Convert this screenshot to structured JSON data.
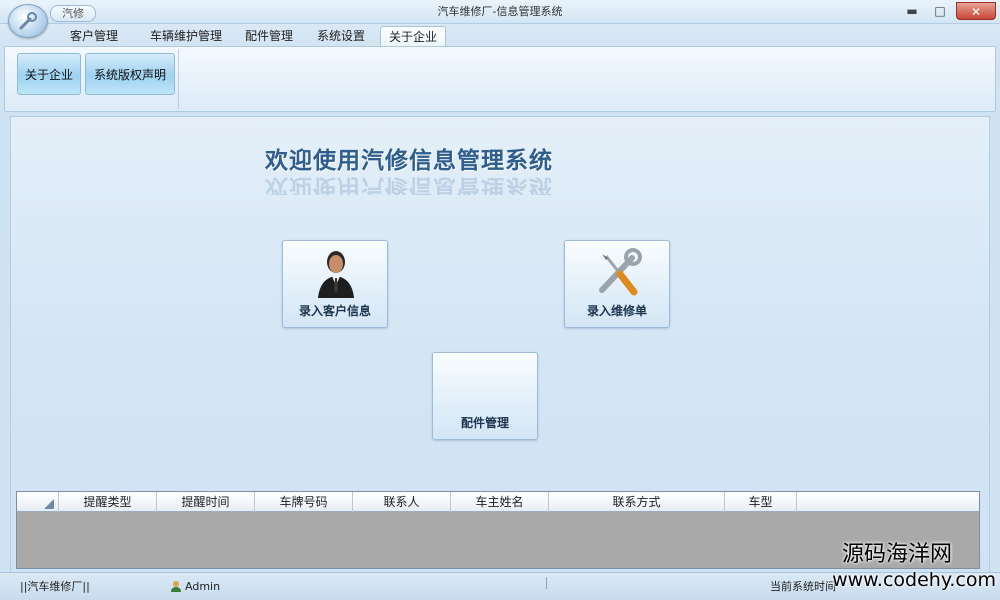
{
  "window": {
    "title": "汽车维修厂-信息管理系统",
    "quick_access": "汽修",
    "controls": {
      "minimize": "▬",
      "maximize": "□",
      "close": "✕"
    }
  },
  "tabs": [
    {
      "label": "客户管理",
      "active": false
    },
    {
      "label": "车辆维护管理",
      "active": false
    },
    {
      "label": "配件管理",
      "active": false
    },
    {
      "label": "系统设置",
      "active": false
    },
    {
      "label": "关于企业",
      "active": true
    }
  ],
  "ribbon": {
    "buttons": [
      {
        "label": "关于企业"
      },
      {
        "label": "系统版权声明"
      }
    ]
  },
  "main": {
    "welcome": "欢迎使用汽修信息管理系统",
    "tiles": [
      {
        "label": "录入客户信息",
        "icon": "customer-person-icon"
      },
      {
        "label": "录入维修单",
        "icon": "repair-tools-icon"
      },
      {
        "label": "配件管理",
        "icon": ""
      }
    ]
  },
  "grid": {
    "columns": [
      "提醒类型",
      "提醒时间",
      "车牌号码",
      "联系人",
      "车主姓名",
      "联系方式",
      "车型"
    ],
    "rows": []
  },
  "status": {
    "company": "||汽车维修厂||",
    "user": "Admin",
    "time_label": "当前系统时间"
  },
  "watermark": {
    "cn": "源码海洋网",
    "url": "www.codehy.com"
  },
  "colors": {
    "accent": "#2f5d8e",
    "ribbon_button": "#9ed2f1",
    "close_button": "#c6473a"
  }
}
